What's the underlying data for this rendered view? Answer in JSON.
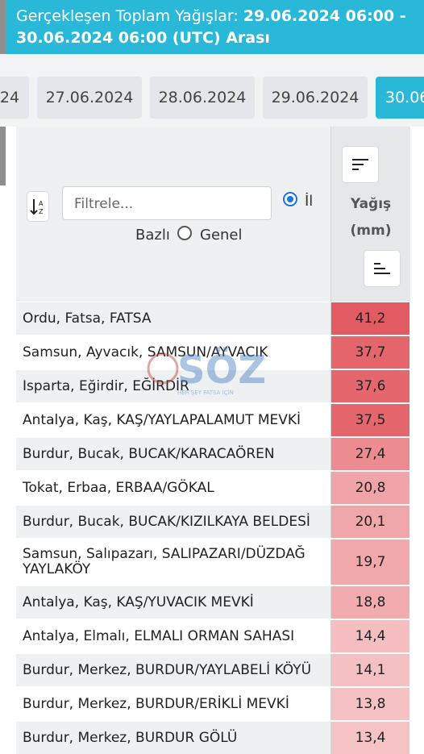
{
  "header": {
    "title_prefix": "Gerçekleşen Toplam Yağışlar: ",
    "title_range": "29.06.2024 06:00 - 30.06.2024 06:00 (UTC) Arası"
  },
  "date_tabs": [
    "24",
    "27.06.2024",
    "28.06.2024",
    "29.06.2024",
    "30.06"
  ],
  "filters": {
    "placeholder": "Filtrele...",
    "option_il": "İl",
    "option_il_suffix": "Bazlı",
    "option_genel": "Genel",
    "selected": "İl Bazlı"
  },
  "column": {
    "title": "Yağış",
    "unit": "(mm)"
  },
  "rows": [
    {
      "place": "Ordu, Fatsa, FATSA",
      "value": "41,2",
      "color": "#e25b63"
    },
    {
      "place": "Samsun, Ayvacık, SAMSUN/AYVACIK",
      "value": "37,7",
      "color": "#e5656c"
    },
    {
      "place": "Isparta, Eğirdir, EĞİRDİR",
      "value": "37,6",
      "color": "#e5666d"
    },
    {
      "place": "Antalya, Kaş, KAŞ/YAYLAPALAMUT MEVKİ",
      "value": "37,5",
      "color": "#e5666d"
    },
    {
      "place": "Burdur, Bucak, BUCAK/KARACAÖREN",
      "value": "27,4",
      "color": "#ec8c91"
    },
    {
      "place": "Tokat, Erbaa, ERBAA/GÖKAL",
      "value": "20,8",
      "color": "#f0a4a8"
    },
    {
      "place": "Burdur, Bucak, BUCAK/KIZILKAYA BELDESİ",
      "value": "20,1",
      "color": "#f0a7aa"
    },
    {
      "place": "Samsun, Salıpazarı, SALIPAZARI/DÜZDAĞ YAYLAKÖY",
      "value": "19,7",
      "color": "#f1a9ac"
    },
    {
      "place": "Antalya, Kaş, KAŞ/YUVACIK MEVKİ",
      "value": "18,8",
      "color": "#f2acaf"
    },
    {
      "place": "Antalya, Elmalı, ELMALI ORMAN SAHASI",
      "value": "14,4",
      "color": "#f5bec0"
    },
    {
      "place": "Burdur, Merkez, BURDUR/YAYLABELİ KÖYÜ",
      "value": "14,1",
      "color": "#f5c0c2"
    },
    {
      "place": "Burdur, Merkez, BURDUR/ERİKLİ MEVKİ",
      "value": "13,8",
      "color": "#f5c1c3"
    },
    {
      "place": "Burdur, Merkez, BURDUR GÖLÜ",
      "value": "13,4",
      "color": "#f6c3c5"
    }
  ],
  "watermark": {
    "text": "SÖZ",
    "tagline": "HER ŞEY FATSA İÇİN"
  },
  "icons": {
    "sort_az": "sort-alpha-icon",
    "sort_desc": "sort-descending-icon",
    "sort_asc": "sort-ascending-icon"
  }
}
